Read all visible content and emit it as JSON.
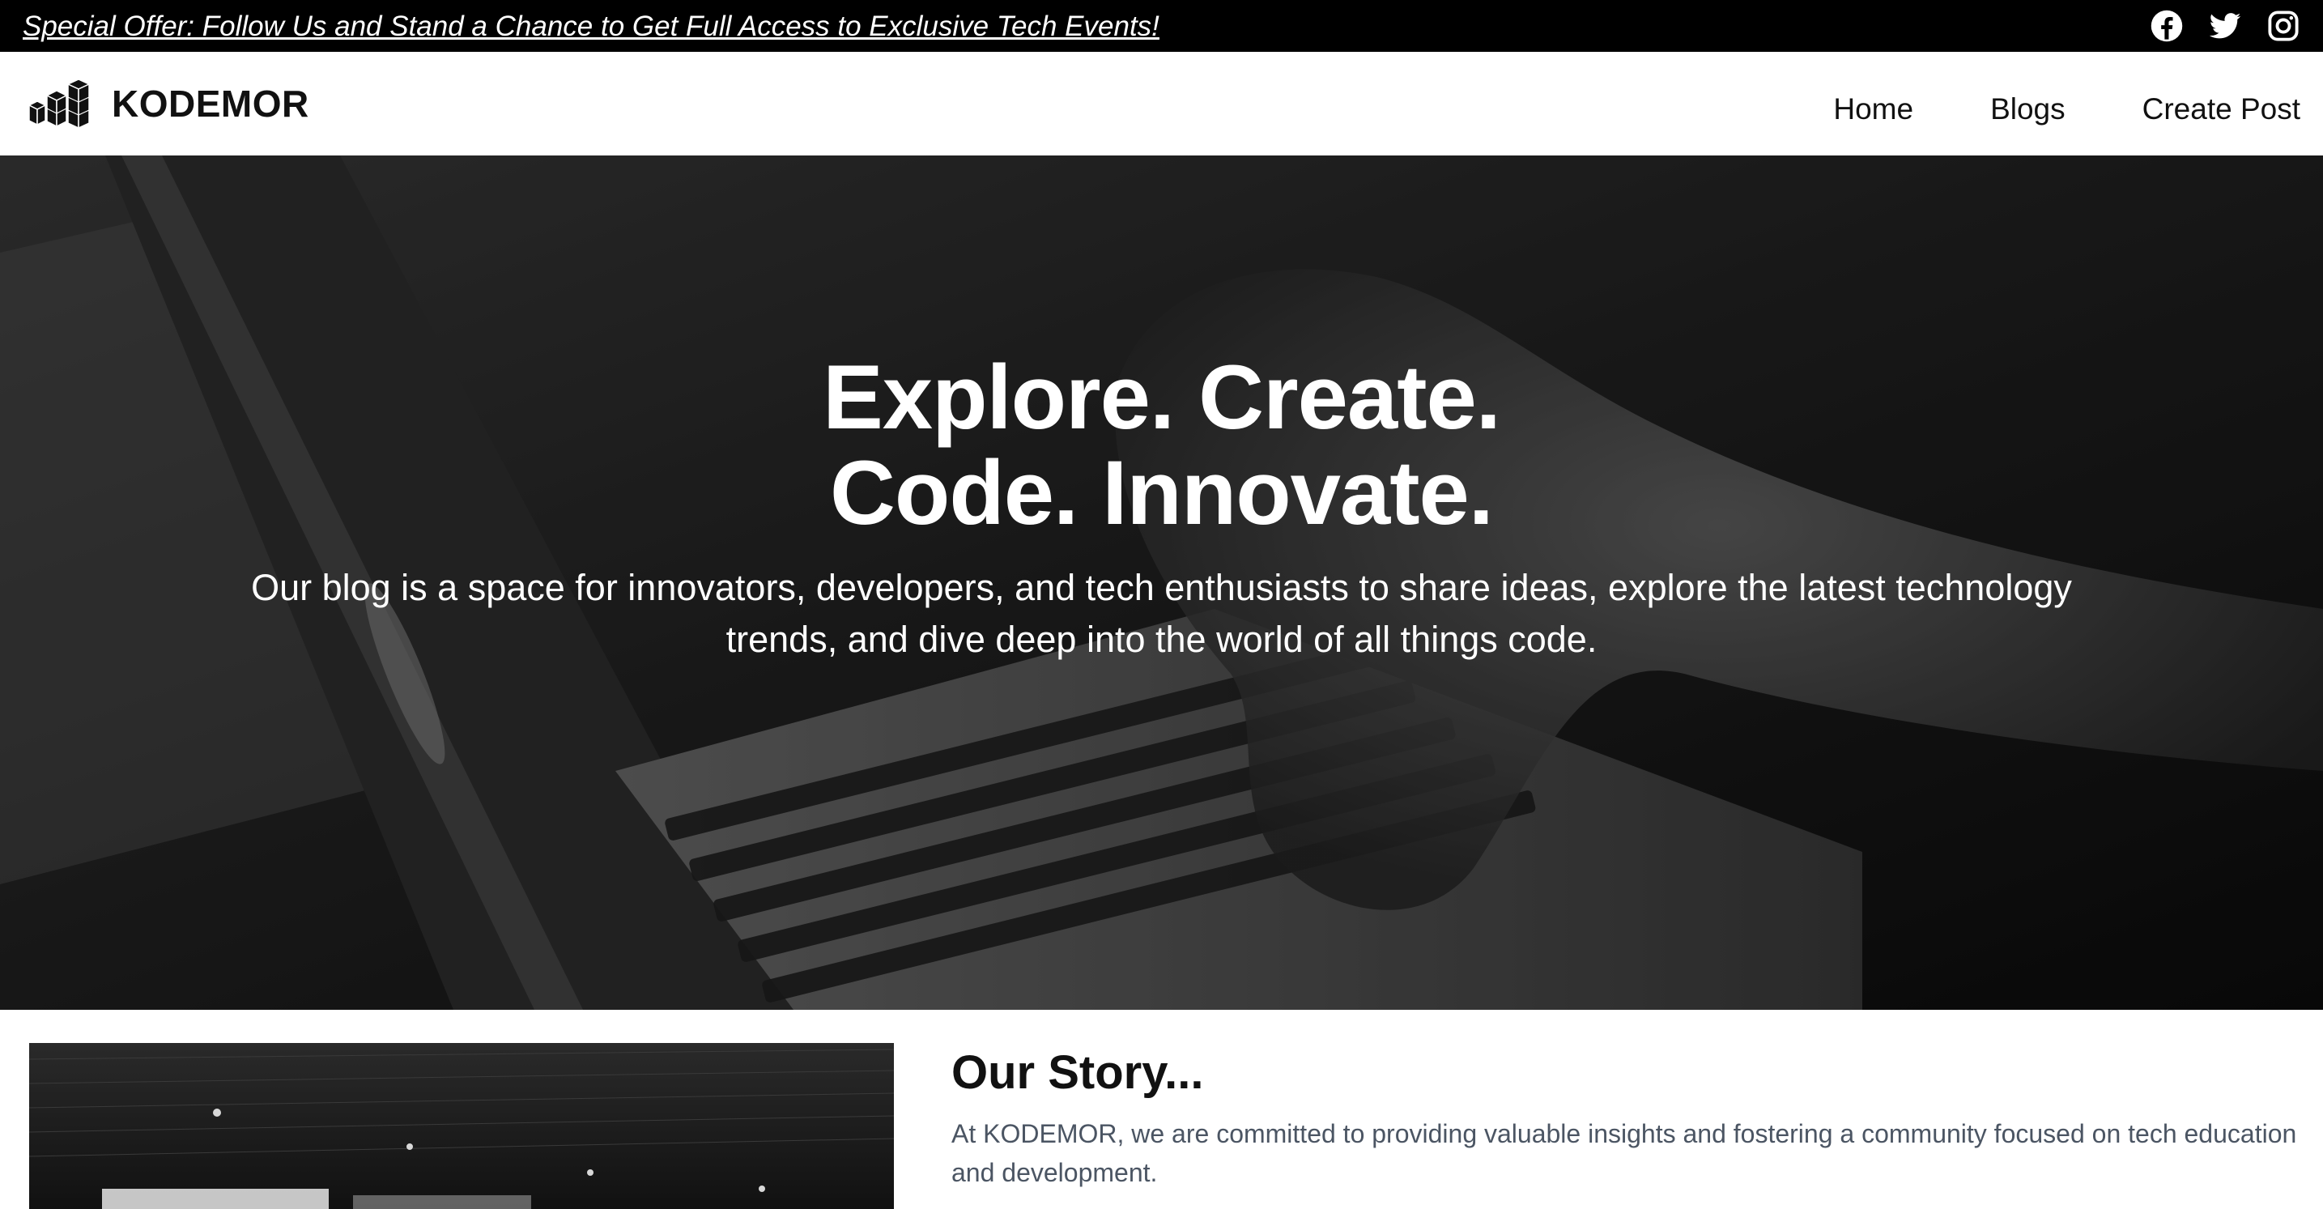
{
  "promo": {
    "text": "Special Offer: Follow Us and Stand a Chance to Get Full Access to Exclusive Tech Events!"
  },
  "social": [
    "facebook-icon",
    "twitter-icon",
    "instagram-icon"
  ],
  "brand": {
    "name": "KODEMOR"
  },
  "nav": {
    "home": "Home",
    "blogs": "Blogs",
    "create_post": "Create Post"
  },
  "hero": {
    "title_line1": "Explore. Create.",
    "title_line2": "Code. Innovate.",
    "subtitle": "Our blog is a space for innovators, developers, and tech enthusiasts to share ideas, explore the latest technology trends, and dive deep into the world of all things code."
  },
  "story": {
    "title": "Our Story...",
    "body": "At KODEMOR, we are committed to providing valuable insights and fostering a community focused on tech education and development."
  },
  "colors": {
    "promo_bg": "#000000",
    "text_primary": "#111111",
    "text_muted": "#4b5563",
    "hero_text": "#ffffff"
  }
}
